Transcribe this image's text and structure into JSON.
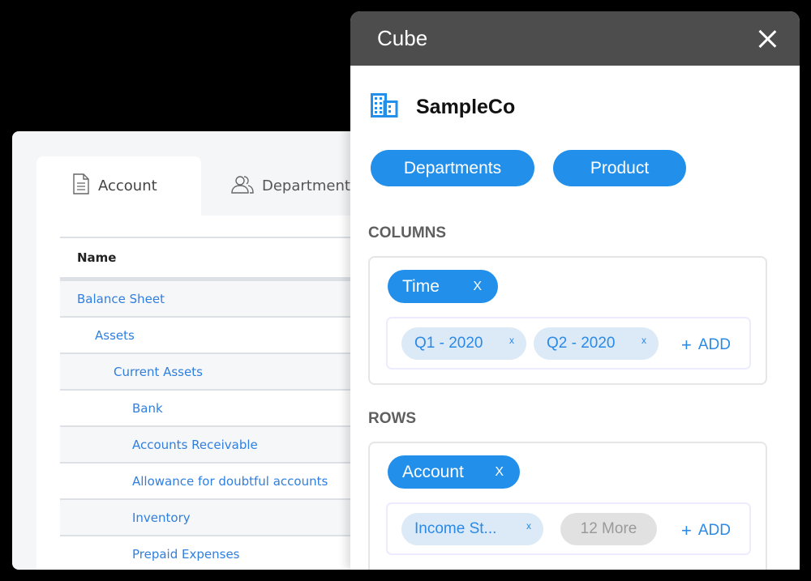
{
  "back_panel": {
    "tabs": [
      {
        "label": "Account",
        "icon": "document-icon",
        "active": true
      },
      {
        "label": "Department",
        "icon": "users-icon",
        "active": false
      }
    ],
    "tree": {
      "header": "Name",
      "rows": [
        {
          "label": "Balance Sheet",
          "level": 0
        },
        {
          "label": "Assets",
          "level": 1
        },
        {
          "label": "Current Assets",
          "level": 2
        },
        {
          "label": "Bank",
          "level": 3
        },
        {
          "label": "Accounts Receivable",
          "level": 3
        },
        {
          "label": "Allowance for doubtful accounts",
          "level": 3
        },
        {
          "label": "Inventory",
          "level": 3
        },
        {
          "label": "Prepaid Expenses",
          "level": 3
        }
      ]
    }
  },
  "dialog": {
    "title": "Cube",
    "close_icon": "close-icon",
    "company": {
      "icon": "building-icon",
      "name": "SampleCo"
    },
    "dimension_buttons": [
      "Departments",
      "Product"
    ],
    "columns": {
      "label": "COLUMNS",
      "dimension": "Time",
      "remove_glyph": "X",
      "members": [
        "Q1 - 2020",
        "Q2 - 2020"
      ],
      "member_remove_glyph": "x",
      "add_label": "ADD",
      "add_glyph": "+"
    },
    "rows": {
      "label": "ROWS",
      "dimension": "Account",
      "remove_glyph": "X",
      "members": [
        "Income St..."
      ],
      "member_remove_glyph": "x",
      "more_label": "12 More",
      "add_label": "ADD",
      "add_glyph": "+"
    }
  },
  "colors": {
    "accent": "#2290ea",
    "link": "#2f7fe0",
    "header_bg": "#4d4d4d",
    "chip_bg": "#dce9f6",
    "section_label": "#5f5f5f"
  }
}
